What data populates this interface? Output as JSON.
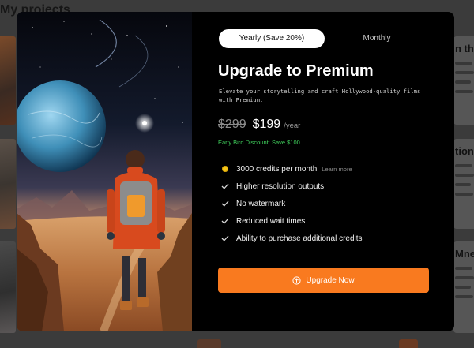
{
  "background": {
    "page_title": "My projects",
    "card_titles": [
      "n th",
      "tion",
      "Mne"
    ]
  },
  "modal": {
    "billing_toggle": {
      "options": [
        "Yearly (Save 20%)",
        "Monthly"
      ],
      "selected": "Yearly (Save 20%)"
    },
    "title": "Upgrade to Premium",
    "subtitle": "Elevate your storytelling and craft Hollywood-quality films with Premium.",
    "pricing": {
      "original_price": "$299",
      "price": "$199",
      "period": "/year",
      "discount_note": "Early Bird Discount: Save $100"
    },
    "features": [
      {
        "label": "3000 credits per month",
        "icon": "coin-icon",
        "link": "Learn more"
      },
      {
        "label": "Higher resolution outputs",
        "icon": "check-icon"
      },
      {
        "label": "No watermark",
        "icon": "check-icon"
      },
      {
        "label": "Reduced wait times",
        "icon": "check-icon"
      },
      {
        "label": "Ability to purchase additional credits",
        "icon": "check-icon"
      }
    ],
    "cta_label": "Upgrade Now",
    "cta_icon": "arrow-up-circle-icon"
  },
  "colors": {
    "accent": "#f97a1f",
    "discount": "#3fcf5b",
    "coin": "#f5c518",
    "modal_bg": "#000000",
    "overlay": "#3b3b3b"
  }
}
